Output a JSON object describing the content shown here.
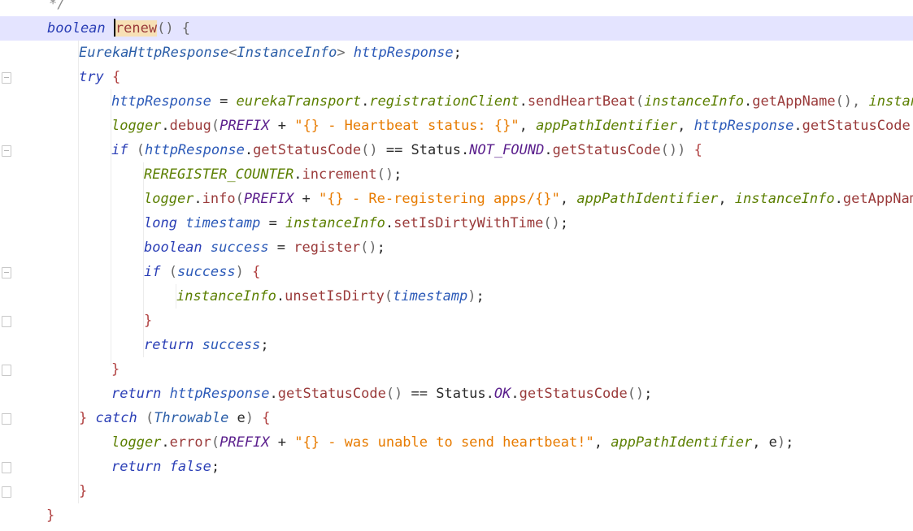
{
  "editor": {
    "lines": [
      {
        "segments": [
          {
            "c": "cmt",
            "t": "*/"
          }
        ]
      },
      {
        "segments": [
          {
            "c": "kw",
            "t": "boolean"
          },
          {
            "c": "plain",
            "t": " "
          },
          {
            "c": "caret",
            "t": ""
          },
          {
            "c": "meth hl",
            "t": "renew"
          },
          {
            "c": "punc",
            "t": "() {"
          }
        ]
      },
      {
        "segments": [
          {
            "c": "ty",
            "t": "EurekaHttpResponse"
          },
          {
            "c": "punc",
            "t": "<"
          },
          {
            "c": "ty",
            "t": "InstanceInfo"
          },
          {
            "c": "punc",
            "t": "> "
          },
          {
            "c": "var",
            "t": "httpResponse"
          },
          {
            "c": "plain",
            "t": ";"
          }
        ]
      },
      {
        "segments": [
          {
            "c": "kw",
            "t": "try"
          },
          {
            "c": "plain",
            "t": " "
          },
          {
            "c": "brace",
            "t": "{"
          }
        ]
      },
      {
        "segments": [
          {
            "c": "var",
            "t": "httpResponse"
          },
          {
            "c": "plain",
            "t": " = "
          },
          {
            "c": "field",
            "t": "eurekaTransport"
          },
          {
            "c": "plain",
            "t": "."
          },
          {
            "c": "field",
            "t": "registrationClient"
          },
          {
            "c": "plain",
            "t": "."
          },
          {
            "c": "meth",
            "t": "sendHeartBeat"
          },
          {
            "c": "punc",
            "t": "("
          },
          {
            "c": "field",
            "t": "instanceInfo"
          },
          {
            "c": "plain",
            "t": "."
          },
          {
            "c": "meth",
            "t": "getAppName"
          },
          {
            "c": "punc",
            "t": "(), "
          },
          {
            "c": "field",
            "t": "instanceI"
          }
        ]
      },
      {
        "segments": [
          {
            "c": "field",
            "t": "logger"
          },
          {
            "c": "plain",
            "t": "."
          },
          {
            "c": "meth",
            "t": "debug"
          },
          {
            "c": "punc",
            "t": "("
          },
          {
            "c": "const",
            "t": "PREFIX"
          },
          {
            "c": "plain",
            "t": " + "
          },
          {
            "c": "str",
            "t": "\"{} - Heartbeat status: {}\""
          },
          {
            "c": "plain",
            "t": ", "
          },
          {
            "c": "field",
            "t": "appPathIdentifier"
          },
          {
            "c": "plain",
            "t": ", "
          },
          {
            "c": "var",
            "t": "httpResponse"
          },
          {
            "c": "plain",
            "t": "."
          },
          {
            "c": "meth",
            "t": "getStatusCode"
          },
          {
            "c": "punc",
            "t": "())"
          }
        ]
      },
      {
        "segments": [
          {
            "c": "kw",
            "t": "if"
          },
          {
            "c": "plain",
            "t": " "
          },
          {
            "c": "punc",
            "t": "("
          },
          {
            "c": "var",
            "t": "httpResponse"
          },
          {
            "c": "plain",
            "t": "."
          },
          {
            "c": "meth",
            "t": "getStatusCode"
          },
          {
            "c": "punc",
            "t": "()"
          },
          {
            "c": "plain",
            "t": " == Status."
          },
          {
            "c": "const",
            "t": "NOT_FOUND"
          },
          {
            "c": "plain",
            "t": "."
          },
          {
            "c": "meth",
            "t": "getStatusCode"
          },
          {
            "c": "punc",
            "t": "()) "
          },
          {
            "c": "brace",
            "t": "{"
          }
        ]
      },
      {
        "segments": [
          {
            "c": "field",
            "t": "REREGISTER_COUNTER"
          },
          {
            "c": "plain",
            "t": "."
          },
          {
            "c": "meth",
            "t": "increment"
          },
          {
            "c": "punc",
            "t": "()"
          },
          {
            "c": "plain",
            "t": ";"
          }
        ]
      },
      {
        "segments": [
          {
            "c": "field",
            "t": "logger"
          },
          {
            "c": "plain",
            "t": "."
          },
          {
            "c": "meth",
            "t": "info"
          },
          {
            "c": "punc",
            "t": "("
          },
          {
            "c": "const",
            "t": "PREFIX"
          },
          {
            "c": "plain",
            "t": " + "
          },
          {
            "c": "str",
            "t": "\"{} - Re-registering apps/{}\""
          },
          {
            "c": "plain",
            "t": ", "
          },
          {
            "c": "field",
            "t": "appPathIdentifier"
          },
          {
            "c": "plain",
            "t": ", "
          },
          {
            "c": "field",
            "t": "instanceInfo"
          },
          {
            "c": "plain",
            "t": "."
          },
          {
            "c": "meth",
            "t": "getAppName("
          }
        ]
      },
      {
        "segments": [
          {
            "c": "kw",
            "t": "long"
          },
          {
            "c": "plain",
            "t": " "
          },
          {
            "c": "var",
            "t": "timestamp"
          },
          {
            "c": "plain",
            "t": " = "
          },
          {
            "c": "field",
            "t": "instanceInfo"
          },
          {
            "c": "plain",
            "t": "."
          },
          {
            "c": "meth",
            "t": "setIsDirtyWithTime"
          },
          {
            "c": "punc",
            "t": "()"
          },
          {
            "c": "plain",
            "t": ";"
          }
        ]
      },
      {
        "segments": [
          {
            "c": "kw",
            "t": "boolean"
          },
          {
            "c": "plain",
            "t": " "
          },
          {
            "c": "var",
            "t": "success"
          },
          {
            "c": "plain",
            "t": " = "
          },
          {
            "c": "meth",
            "t": "register"
          },
          {
            "c": "punc",
            "t": "()"
          },
          {
            "c": "plain",
            "t": ";"
          }
        ]
      },
      {
        "segments": [
          {
            "c": "kw",
            "t": "if"
          },
          {
            "c": "plain",
            "t": " "
          },
          {
            "c": "punc",
            "t": "("
          },
          {
            "c": "var",
            "t": "success"
          },
          {
            "c": "punc",
            "t": ") "
          },
          {
            "c": "brace",
            "t": "{"
          }
        ]
      },
      {
        "segments": [
          {
            "c": "field",
            "t": "instanceInfo"
          },
          {
            "c": "plain",
            "t": "."
          },
          {
            "c": "meth",
            "t": "unsetIsDirty"
          },
          {
            "c": "punc",
            "t": "("
          },
          {
            "c": "var",
            "t": "timestamp"
          },
          {
            "c": "punc",
            "t": ")"
          },
          {
            "c": "plain",
            "t": ";"
          }
        ]
      },
      {
        "segments": [
          {
            "c": "brace",
            "t": "}"
          }
        ]
      },
      {
        "segments": [
          {
            "c": "kw",
            "t": "return"
          },
          {
            "c": "plain",
            "t": " "
          },
          {
            "c": "var",
            "t": "success"
          },
          {
            "c": "plain",
            "t": ";"
          }
        ]
      },
      {
        "segments": [
          {
            "c": "brace",
            "t": "}"
          }
        ]
      },
      {
        "segments": [
          {
            "c": "kw",
            "t": "return"
          },
          {
            "c": "plain",
            "t": " "
          },
          {
            "c": "var",
            "t": "httpResponse"
          },
          {
            "c": "plain",
            "t": "."
          },
          {
            "c": "meth",
            "t": "getStatusCode"
          },
          {
            "c": "punc",
            "t": "()"
          },
          {
            "c": "plain",
            "t": " == Status."
          },
          {
            "c": "const",
            "t": "OK"
          },
          {
            "c": "plain",
            "t": "."
          },
          {
            "c": "meth",
            "t": "getStatusCode"
          },
          {
            "c": "punc",
            "t": "()"
          },
          {
            "c": "plain",
            "t": ";"
          }
        ]
      },
      {
        "segments": [
          {
            "c": "brace",
            "t": "}"
          },
          {
            "c": "plain",
            "t": " "
          },
          {
            "c": "kw",
            "t": "catch"
          },
          {
            "c": "plain",
            "t": " "
          },
          {
            "c": "punc",
            "t": "("
          },
          {
            "c": "ty",
            "t": "Throwable"
          },
          {
            "c": "plain",
            "t": " e"
          },
          {
            "c": "punc",
            "t": ") "
          },
          {
            "c": "brace",
            "t": "{"
          }
        ]
      },
      {
        "segments": [
          {
            "c": "field",
            "t": "logger"
          },
          {
            "c": "plain",
            "t": "."
          },
          {
            "c": "meth",
            "t": "error"
          },
          {
            "c": "punc",
            "t": "("
          },
          {
            "c": "const",
            "t": "PREFIX"
          },
          {
            "c": "plain",
            "t": " + "
          },
          {
            "c": "str",
            "t": "\"{} - was unable to send heartbeat!\""
          },
          {
            "c": "plain",
            "t": ", "
          },
          {
            "c": "field",
            "t": "appPathIdentifier"
          },
          {
            "c": "plain",
            "t": ", e"
          },
          {
            "c": "punc",
            "t": ")"
          },
          {
            "c": "plain",
            "t": ";"
          }
        ]
      },
      {
        "segments": [
          {
            "c": "kw",
            "t": "return"
          },
          {
            "c": "plain",
            "t": " "
          },
          {
            "c": "kw",
            "t": "false"
          },
          {
            "c": "plain",
            "t": ";"
          }
        ]
      },
      {
        "segments": [
          {
            "c": "brace",
            "t": "}"
          }
        ]
      },
      {
        "segments": [
          {
            "c": "brace",
            "t": "}"
          }
        ]
      }
    ]
  },
  "gutter": {
    "intention_icon": "lightbulb-icon"
  }
}
